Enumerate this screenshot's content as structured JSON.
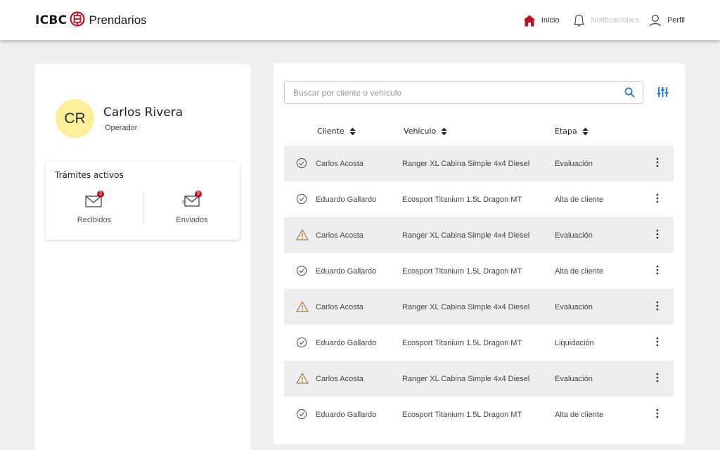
{
  "header": {
    "brand": "ICBC",
    "product": "Prendarios",
    "nav": {
      "home": "Inicio",
      "notifications": "Notificaciones",
      "profile": "Perfil"
    }
  },
  "colors": {
    "accent_red": "#c0111f",
    "accent_blue": "#1a73e8",
    "avatar_bg": "#fbef9a",
    "warning": "#a07a3c"
  },
  "user": {
    "initials": "CR",
    "name": "Carlos Rivera",
    "role": "Operador"
  },
  "tramites": {
    "title": "Trámites activos",
    "received": {
      "label": "Recibidos",
      "count": "3"
    },
    "sent": {
      "label": "Enviados",
      "count": "9"
    }
  },
  "search": {
    "placeholder": "Buscar por cliente o vehículo",
    "value": ""
  },
  "table": {
    "columns": [
      "Cliente",
      "Vehículo",
      "Etapa"
    ],
    "rows": [
      {
        "status": "check-circle-icon",
        "cliente": "Carlos Acosta",
        "vehiculo": "Ranger XL Cabina Simple 4x4 Diesel",
        "etapa": "Evaluación"
      },
      {
        "status": "check-circle-icon",
        "cliente": "Eduardo Gallardo",
        "vehiculo": "Ecosport Titanium 1.5L Dragon MT",
        "etapa": "Alta de cliente"
      },
      {
        "status": "warning-icon",
        "cliente": "Carlos Acosta",
        "vehiculo": "Ranger XL Cabina Simple 4x4 Diesel",
        "etapa": "Evaluación"
      },
      {
        "status": "check-circle-icon",
        "cliente": "Eduardo Gallardo",
        "vehiculo": "Ecosport Titanium 1.5L Dragon MT",
        "etapa": "Alta de cliente"
      },
      {
        "status": "warning-icon",
        "cliente": "Carlos Acosta",
        "vehiculo": "Ranger XL Cabina Simple 4x4 Diesel",
        "etapa": "Evaluación"
      },
      {
        "status": "check-circle-icon",
        "cliente": "Eduardo Gallardo",
        "vehiculo": "Ecosport Titanium 1.5L Dragon MT",
        "etapa": "Liquidación"
      },
      {
        "status": "warning-icon",
        "cliente": "Carlos Acosta",
        "vehiculo": "Ranger XL Cabina Simple 4x4 Diesel",
        "etapa": "Evaluación"
      },
      {
        "status": "check-circle-icon",
        "cliente": "Eduardo Gallardo",
        "vehiculo": "Ecosport Titanium 1.5L Dragon MT",
        "etapa": "Alta de cliente"
      }
    ]
  }
}
